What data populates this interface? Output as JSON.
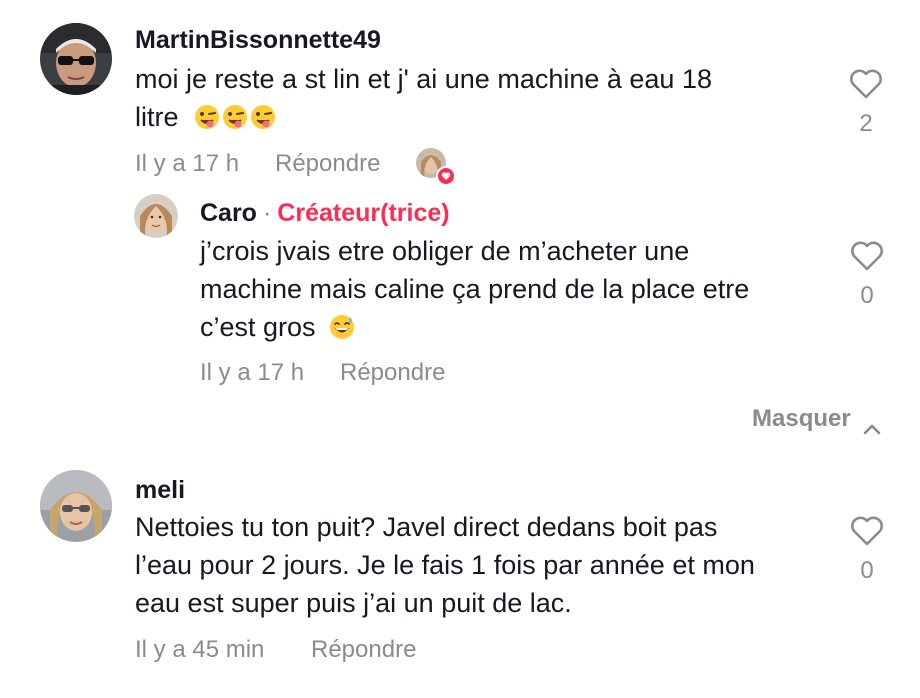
{
  "comments": [
    {
      "username": "MartinBissonnette49",
      "lines": [
        "moi je reste a st lin et j' ai une machine à eau 18",
        "litre"
      ],
      "emojis": [
        "winking-tongue-emoji",
        "winking-tongue-emoji",
        "winking-tongue-emoji"
      ],
      "time": "Il y a 17 h",
      "reply_label": "Répondre",
      "like_count": "2",
      "liked_by_creator": true,
      "replies": [
        {
          "username": "Caro",
          "separator": "·",
          "badge": "Créateur(trice)",
          "lines": [
            "j’crois jvais etre obliger de m’acheter une",
            "machine mais caline ça prend de la place etre",
            "c’est gros"
          ],
          "emojis": [
            "sweat-smile-emoji"
          ],
          "time": "Il y a 17 h",
          "reply_label": "Répondre",
          "like_count": "0"
        }
      ],
      "hide_label": "Masquer"
    },
    {
      "username": "meli",
      "lines": [
        "Nettoies tu ton puit? Javel direct dedans boit pas",
        "l’eau pour 2 jours. Je le fais 1 fois par année et mon",
        "eau est super puis j’ai un puit de lac."
      ],
      "time": "Il y a 45 min",
      "reply_label": "Répondre",
      "like_count": "0"
    }
  ],
  "colors": {
    "text": "#161823",
    "muted": "#8a8b91",
    "accent": "#fe2c55",
    "emoji": "#ffcc33"
  }
}
